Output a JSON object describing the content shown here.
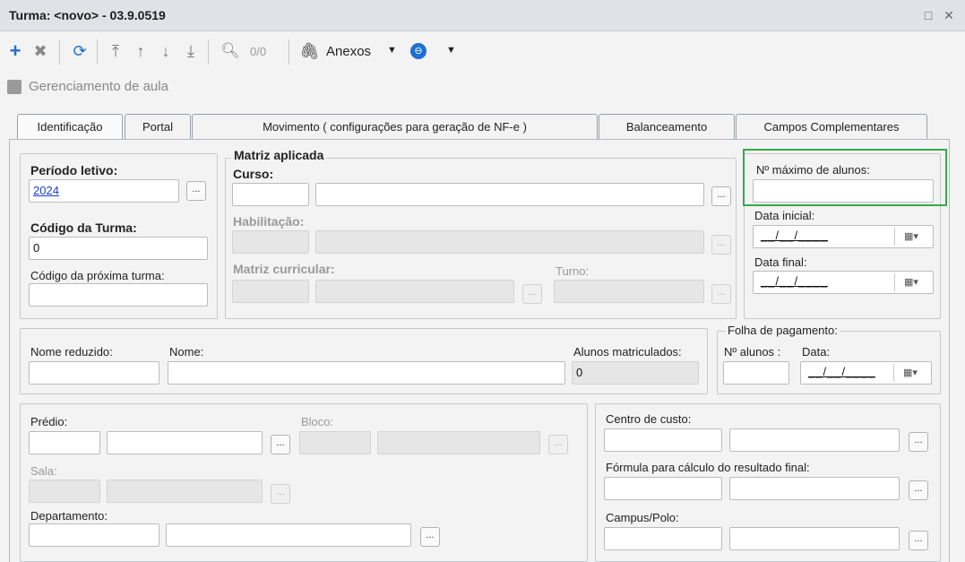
{
  "window": {
    "title": "Turma: <novo> - 03.9.0519",
    "maximize_glyph": "□",
    "close_glyph": "✕"
  },
  "toolbar": {
    "search_count": "0/0",
    "attachments_label": "Anexos"
  },
  "subheader": {
    "label": "Gerenciamento de aula"
  },
  "tabs": [
    {
      "label": "Identificação"
    },
    {
      "label": "Portal"
    },
    {
      "label": "Movimento ( configurações para geração de NF-e )"
    },
    {
      "label": "Balanceamento"
    },
    {
      "label": "Campos Complementares"
    }
  ],
  "form": {
    "periodo_letivo": {
      "label": "Período letivo:",
      "value": "2024"
    },
    "codigo_turma": {
      "label": "Código da Turma:",
      "value": "0"
    },
    "codigo_proxima": {
      "label": "Código da próxima turma:",
      "value": ""
    },
    "matriz": {
      "legend": "Matriz aplicada",
      "curso_label": "Curso:",
      "habilitacao_label": "Habilitação:",
      "matriz_curricular_label": "Matriz curricular:",
      "turno_label": "Turno:"
    },
    "max_alunos": {
      "label": "Nº máximo de alunos:",
      "value": ""
    },
    "data_inicial": {
      "label": "Data inicial:",
      "value": "__/__/____"
    },
    "data_final": {
      "label": "Data final:",
      "value": "__/__/____"
    },
    "nome_reduzido": {
      "label": "Nome reduzido:"
    },
    "nome": {
      "label": "Nome:"
    },
    "alunos_matriculados": {
      "label": "Alunos matriculados:",
      "value": "0"
    },
    "folha": {
      "legend": "Folha de pagamento:",
      "n_alunos_label": "Nº alunos :",
      "data_label": "Data:",
      "data_value": "__/__/____"
    },
    "predio": {
      "label": "Prédio:"
    },
    "bloco": {
      "label": "Bloco:"
    },
    "sala": {
      "label": "Sala:"
    },
    "departamento": {
      "label": "Departamento:"
    },
    "centro_custo": {
      "label": "Centro de custo:"
    },
    "formula": {
      "label": "Fórmula para cálculo do resultado final:"
    },
    "campus": {
      "label": "Campus/Polo:"
    },
    "lookup_glyph": "..."
  },
  "colors": {
    "highlight": "#36a94a",
    "link": "#1a3bd6",
    "add_icon": "#1f6fd1",
    "refresh_icon": "#1f6fd1"
  }
}
